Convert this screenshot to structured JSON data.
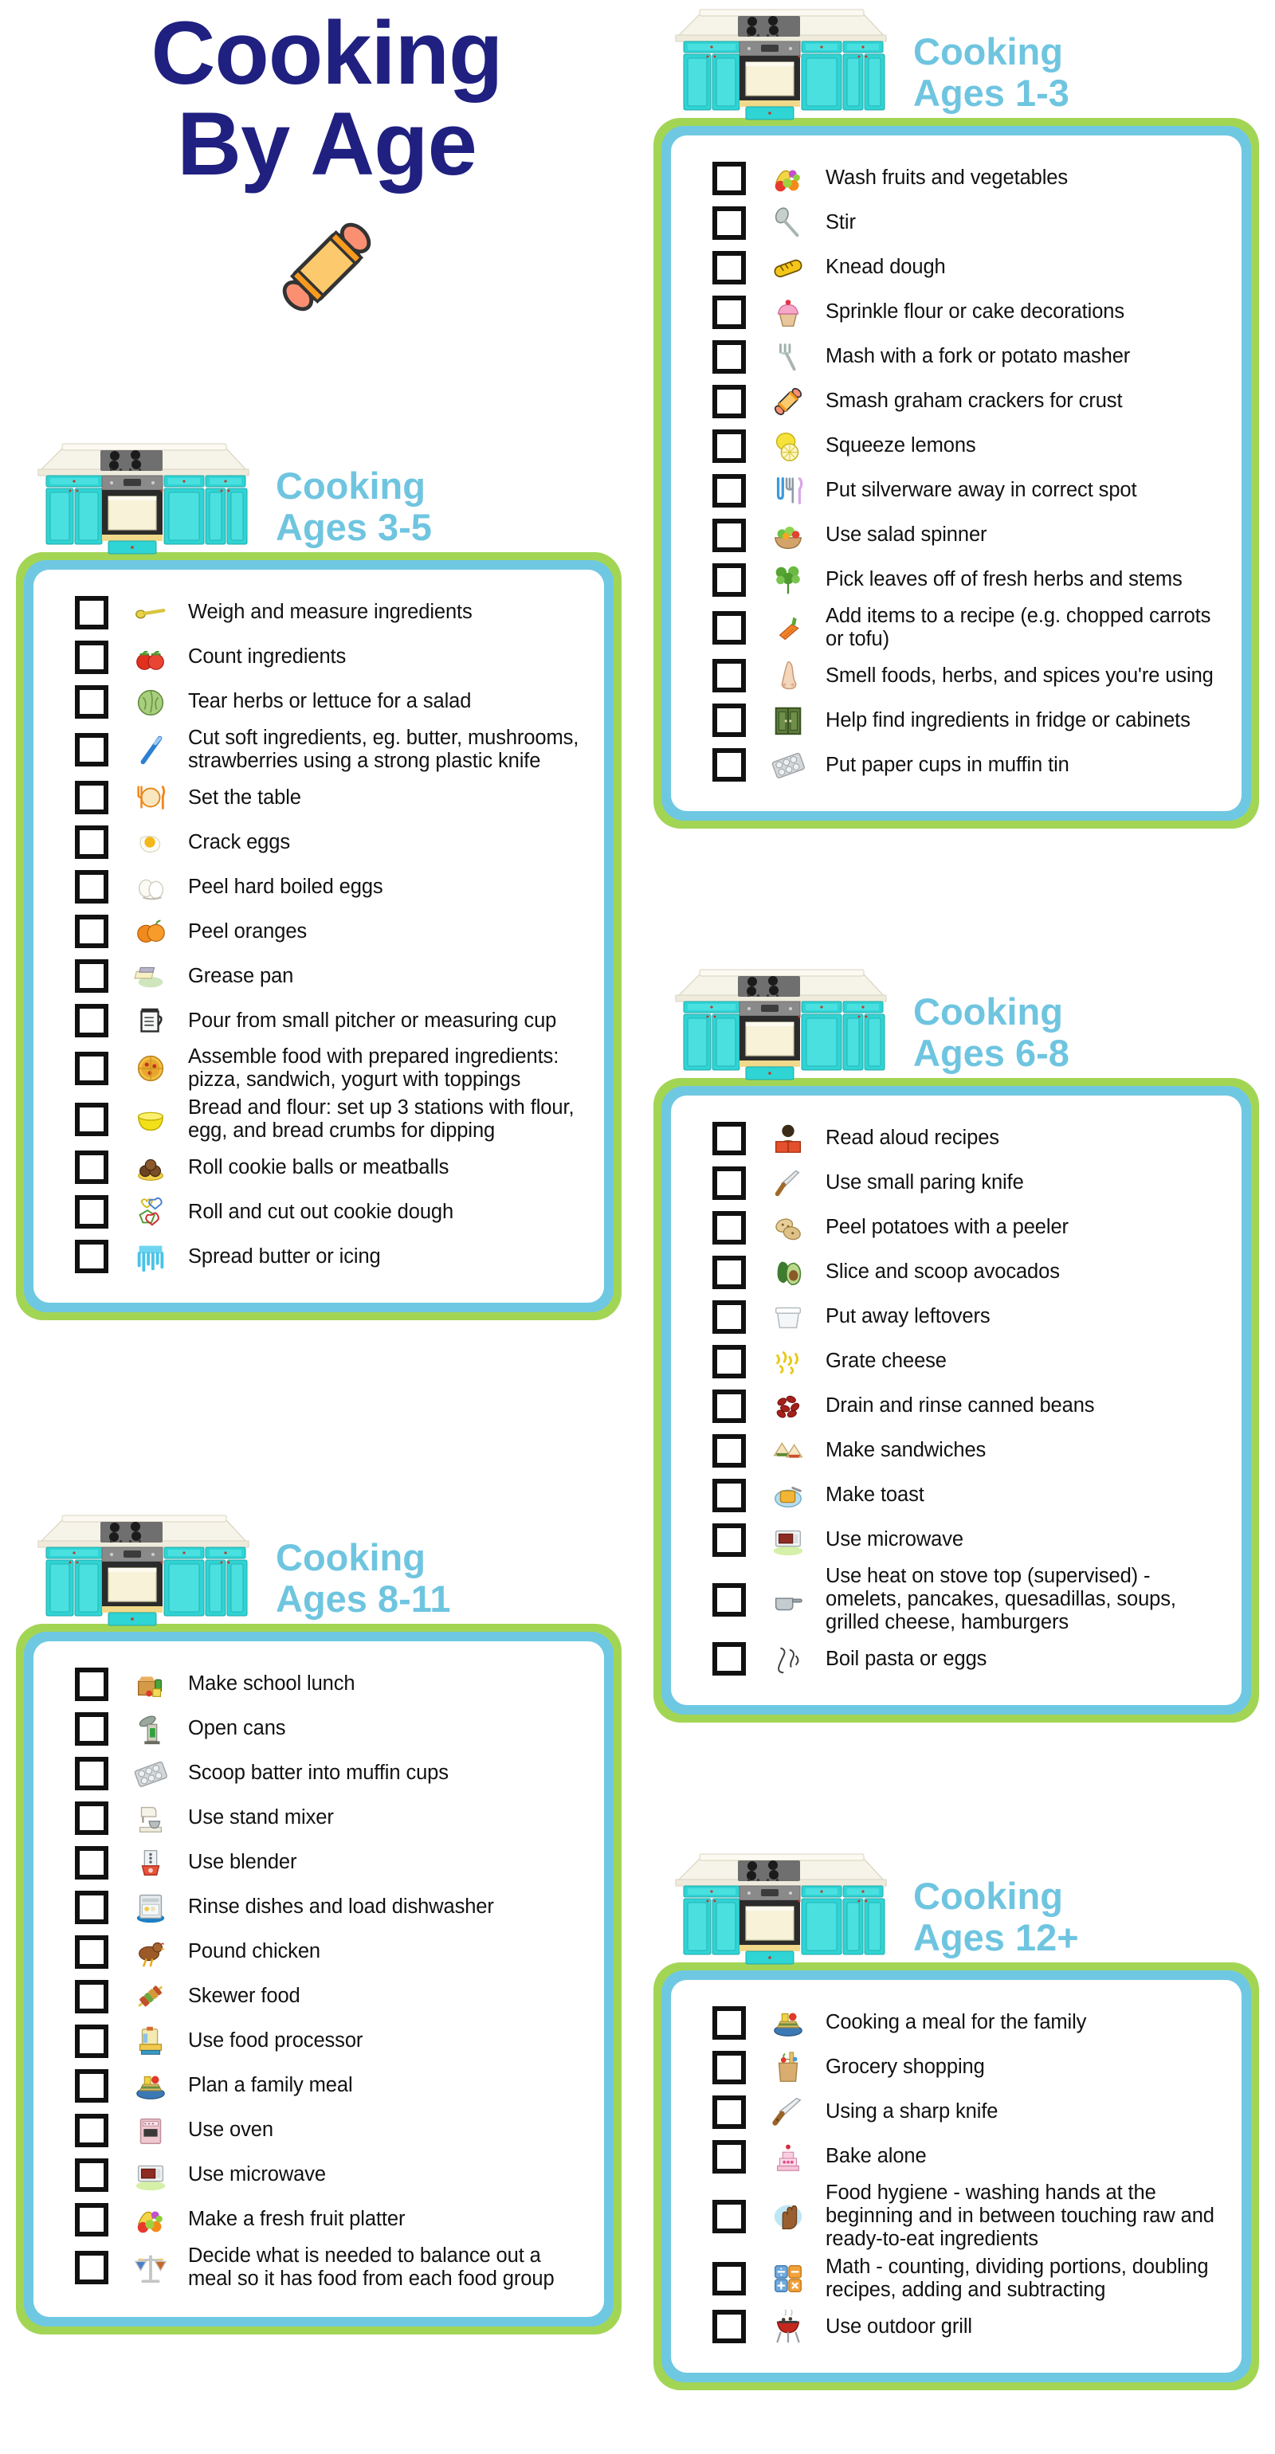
{
  "header": {
    "title_line1": "Cooking",
    "title_line2": "By Age",
    "title_color": "#1f2080",
    "decor_icon": "rolling-pin-icon"
  },
  "theme": {
    "section_title_color": "#6fc5e0",
    "card_outer_border_color": "#a3d555",
    "card_inner_border_color": "#6fc8e2",
    "card_background": "#ffffff",
    "checkbox_border_color": "#111111",
    "cabinet_color": "#3ad6d6"
  },
  "sections": [
    {
      "id": "ages-1-3",
      "title_top": "Cooking",
      "title_bottom": "Ages 1-3",
      "illustration": "kitchen-stove-icon",
      "items": [
        {
          "icon": "fruit-basket-icon",
          "label": "Wash fruits and vegetables"
        },
        {
          "icon": "spoon-icon",
          "label": "Stir"
        },
        {
          "icon": "bread-loaf-icon",
          "label": "Knead dough"
        },
        {
          "icon": "cupcake-icon",
          "label": "Sprinkle flour or cake decorations"
        },
        {
          "icon": "fork-icon",
          "label": "Mash with a fork or potato masher"
        },
        {
          "icon": "rolling-pin-icon",
          "label": "Smash graham crackers for crust"
        },
        {
          "icon": "lemon-icon",
          "label": "Squeeze lemons"
        },
        {
          "icon": "silverware-icon",
          "label": "Put silverware away in correct spot"
        },
        {
          "icon": "salad-bowl-icon",
          "label": "Use salad spinner"
        },
        {
          "icon": "herbs-icon",
          "label": "Pick leaves off of fresh herbs and stems"
        },
        {
          "icon": "carrots-icon",
          "label": "Add items to a recipe (e.g. chopped carrots or tofu)"
        },
        {
          "icon": "nose-icon",
          "label": "Smell foods, herbs, and spices you're using"
        },
        {
          "icon": "cabinet-icon",
          "label": "Help find ingredients in fridge or cabinets"
        },
        {
          "icon": "muffin-tin-icon",
          "label": "Put paper cups in muffin tin"
        }
      ]
    },
    {
      "id": "ages-3-5",
      "title_top": "Cooking",
      "title_bottom": "Ages 3-5",
      "illustration": "kitchen-stove-icon",
      "items": [
        {
          "icon": "measuring-spoon-icon",
          "label": "Weigh and measure ingredients"
        },
        {
          "icon": "tomatoes-icon",
          "label": "Count ingredients"
        },
        {
          "icon": "lettuce-icon",
          "label": "Tear herbs or lettuce for a salad"
        },
        {
          "icon": "plastic-knife-icon",
          "label": "Cut soft ingredients, eg. butter, mushrooms, strawberries using a strong plastic knife"
        },
        {
          "icon": "place-setting-icon",
          "label": "Set the table"
        },
        {
          "icon": "fried-egg-icon",
          "label": "Crack eggs"
        },
        {
          "icon": "boiled-eggs-icon",
          "label": "Peel hard boiled eggs"
        },
        {
          "icon": "oranges-icon",
          "label": "Peel oranges"
        },
        {
          "icon": "butter-icon",
          "label": "Grease pan"
        },
        {
          "icon": "measuring-cup-icon",
          "label": "Pour from small pitcher or measuring cup"
        },
        {
          "icon": "pizza-icon",
          "label": "Assemble food with prepared ingredients: pizza, sandwich, yogurt with toppings"
        },
        {
          "icon": "yellow-bowl-icon",
          "label": "Bread and flour: set up 3 stations with flour, egg, and bread crumbs for dipping"
        },
        {
          "icon": "meatballs-icon",
          "label": "Roll cookie balls or meatballs"
        },
        {
          "icon": "cookie-cutters-icon",
          "label": "Roll and cut out cookie dough"
        },
        {
          "icon": "icing-drip-icon",
          "label": "Spread butter or icing"
        }
      ]
    },
    {
      "id": "ages-6-8",
      "title_top": "Cooking",
      "title_bottom": "Ages 6-8",
      "illustration": "kitchen-stove-icon",
      "items": [
        {
          "icon": "reading-person-icon",
          "label": "Read aloud recipes"
        },
        {
          "icon": "paring-knife-icon",
          "label": "Use small paring knife"
        },
        {
          "icon": "potatoes-icon",
          "label": "Peel potatoes with a peeler"
        },
        {
          "icon": "avocado-icon",
          "label": "Slice and scoop avocados"
        },
        {
          "icon": "container-icon",
          "label": "Put away leftovers"
        },
        {
          "icon": "grated-cheese-icon",
          "label": "Grate cheese"
        },
        {
          "icon": "kidney-beans-icon",
          "label": "Drain and rinse canned beans"
        },
        {
          "icon": "sandwich-icon",
          "label": "Make sandwiches"
        },
        {
          "icon": "toast-plate-icon",
          "label": "Make toast"
        },
        {
          "icon": "microwave-icon",
          "label": "Use microwave"
        },
        {
          "icon": "saucepan-icon",
          "label": "Use heat on stove top (supervised) - omelets, pancakes, quesadillas, soups, grilled cheese, hamburgers"
        },
        {
          "icon": "pasta-icon",
          "label": "Boil pasta or eggs"
        }
      ]
    },
    {
      "id": "ages-8-11",
      "title_top": "Cooking",
      "title_bottom": "Ages 8-11",
      "illustration": "kitchen-stove-icon",
      "items": [
        {
          "icon": "lunch-box-icon",
          "label": "Make school lunch"
        },
        {
          "icon": "can-opener-icon",
          "label": "Open cans"
        },
        {
          "icon": "muffin-tin-icon",
          "label": "Scoop batter into muffin cups"
        },
        {
          "icon": "stand-mixer-icon",
          "label": "Use stand mixer"
        },
        {
          "icon": "blender-icon",
          "label": "Use blender"
        },
        {
          "icon": "dishwasher-icon",
          "label": "Rinse dishes and load dishwasher"
        },
        {
          "icon": "chicken-icon",
          "label": "Pound chicken"
        },
        {
          "icon": "kebab-skewer-icon",
          "label": "Skewer food"
        },
        {
          "icon": "food-processor-icon",
          "label": "Use food processor"
        },
        {
          "icon": "meal-plate-icon",
          "label": "Plan a family meal"
        },
        {
          "icon": "oven-icon",
          "label": "Use oven"
        },
        {
          "icon": "microwave-icon",
          "label": "Use microwave"
        },
        {
          "icon": "fruit-basket-icon",
          "label": "Make a fresh fruit platter"
        },
        {
          "icon": "balance-scale-icon",
          "label": "Decide what is needed to balance out a meal so it has food from each food group"
        }
      ]
    },
    {
      "id": "ages-12",
      "title_top": "Cooking",
      "title_bottom": "Ages 12+",
      "illustration": "kitchen-stove-icon",
      "items": [
        {
          "icon": "meal-plate-icon",
          "label": "Cooking a meal for the family"
        },
        {
          "icon": "grocery-bag-icon",
          "label": "Grocery shopping"
        },
        {
          "icon": "sharp-knife-icon",
          "label": "Using a sharp knife"
        },
        {
          "icon": "layer-cake-icon",
          "label": "Bake alone"
        },
        {
          "icon": "washing-hands-icon",
          "label": "Food hygiene - washing hands at the beginning and in between touching raw and ready-to-eat ingredients"
        },
        {
          "icon": "math-symbols-icon",
          "label": "Math - counting, dividing portions, doubling recipes, adding and subtracting"
        },
        {
          "icon": "bbq-grill-icon",
          "label": "Use outdoor grill"
        }
      ]
    }
  ]
}
